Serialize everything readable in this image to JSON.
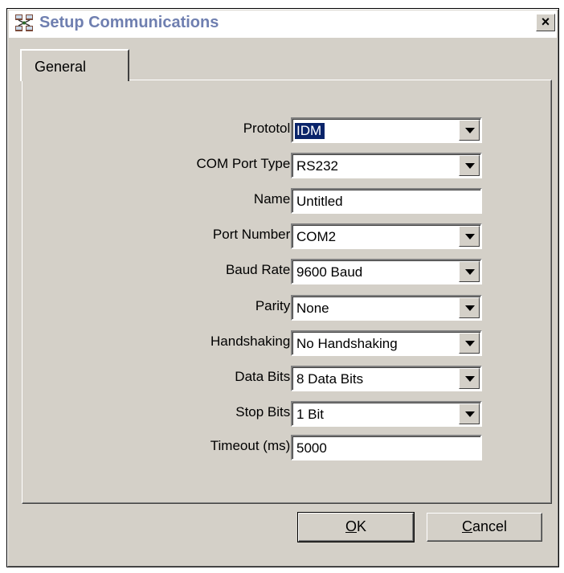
{
  "window": {
    "title": "Setup Communications",
    "close_label": "×",
    "icon": "network-computers-icon"
  },
  "tabs": [
    {
      "label": "General",
      "selected": true
    }
  ],
  "form": {
    "fields": [
      {
        "label": "Prototol:",
        "value": "IDM",
        "type": "dropdown",
        "focused": true
      },
      {
        "label": "COM Port Type:",
        "value": "RS232",
        "type": "dropdown"
      },
      {
        "label": "Name:",
        "value": "Untitled",
        "type": "text"
      },
      {
        "label": "Port Number:",
        "value": "COM2",
        "type": "dropdown"
      },
      {
        "label": "Baud Rate:",
        "value": "9600 Baud",
        "type": "dropdown"
      },
      {
        "label": "Parity:",
        "value": "None",
        "type": "dropdown"
      },
      {
        "label": "Handshaking:",
        "value": "No Handshaking",
        "type": "dropdown"
      },
      {
        "label": "Data Bits:",
        "value": "8 Data Bits",
        "type": "dropdown"
      },
      {
        "label": "Stop Bits:",
        "value": "1 Bit",
        "type": "dropdown"
      },
      {
        "label": "Timeout (ms):",
        "value": "5000",
        "type": "text"
      }
    ]
  },
  "buttons": {
    "ok": {
      "mnemonic": "O",
      "rest": "K"
    },
    "cancel": {
      "mnemonic": "C",
      "rest": "ancel"
    }
  },
  "colors": {
    "dialog_face": "#d4d0c8",
    "title_text": "#6f7fb0",
    "selection": "#0a246a"
  }
}
